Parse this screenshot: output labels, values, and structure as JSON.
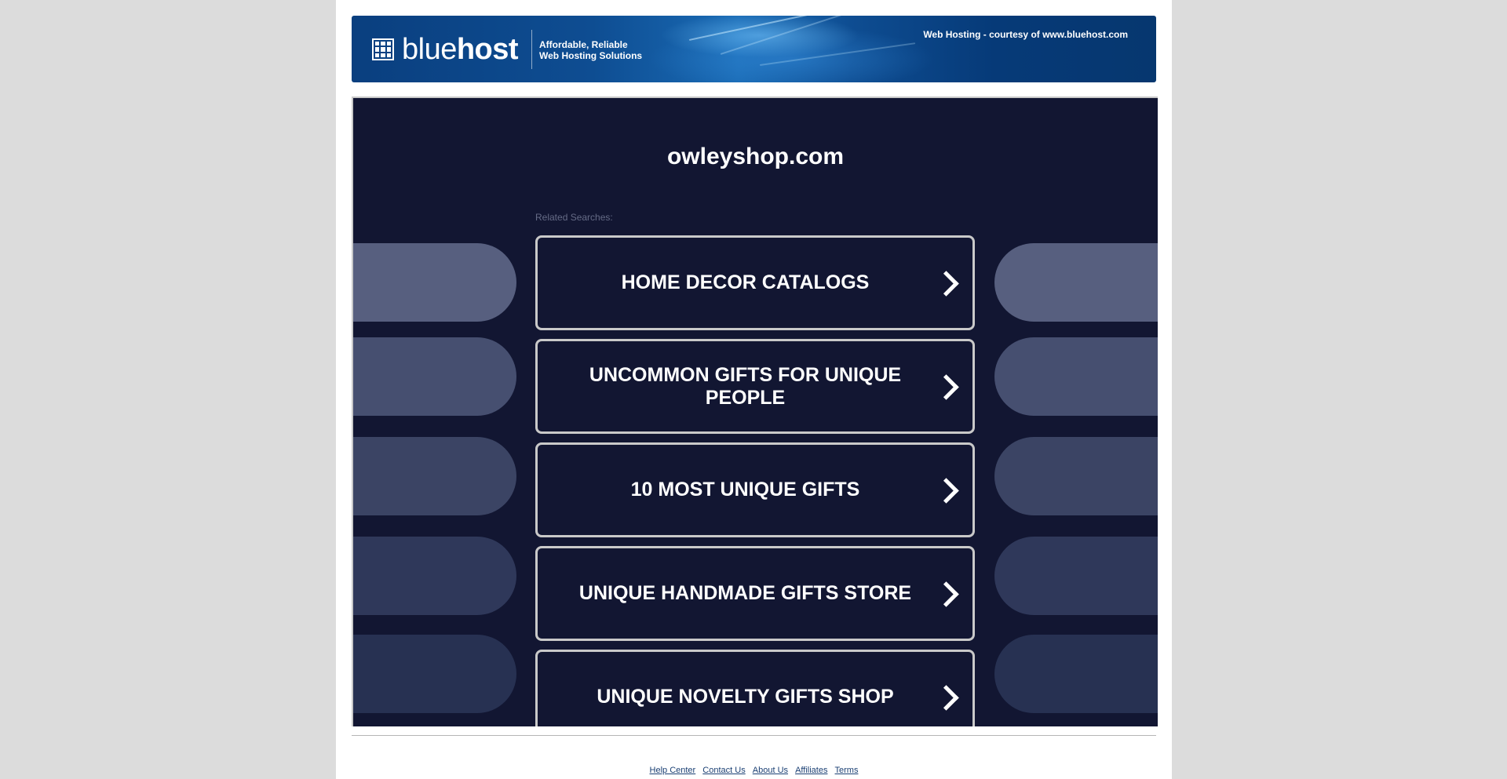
{
  "header": {
    "logo_light": "blue",
    "logo_bold": "host",
    "tagline_line1": "Affordable, Reliable",
    "tagline_line2": "Web Hosting Solutions",
    "courtesy": "Web Hosting - courtesy of www.bluehost.com"
  },
  "main": {
    "domain": "owleyshop.com",
    "related_label": "Related Searches:",
    "links": [
      "HOME DECOR CATALOGS",
      "UNCOMMON GIFTS FOR UNIQUE PEOPLE",
      "10 MOST UNIQUE GIFTS",
      "UNIQUE HANDMADE GIFTS STORE",
      "UNIQUE NOVELTY GIFTS SHOP"
    ]
  },
  "footer": {
    "links": [
      "Help Center",
      "Contact Us",
      "About Us",
      "Affiliates",
      "Terms"
    ]
  },
  "colors": {
    "page_bg": "#dcdcdc",
    "banner_blue": "#0e4d92",
    "main_bg": "#121632",
    "button_border": "#c9c9c9",
    "footer_link": "#1a3f73"
  },
  "icons": {
    "logo": "grid-square-icon",
    "link_arrow": "chevron-right-icon"
  }
}
